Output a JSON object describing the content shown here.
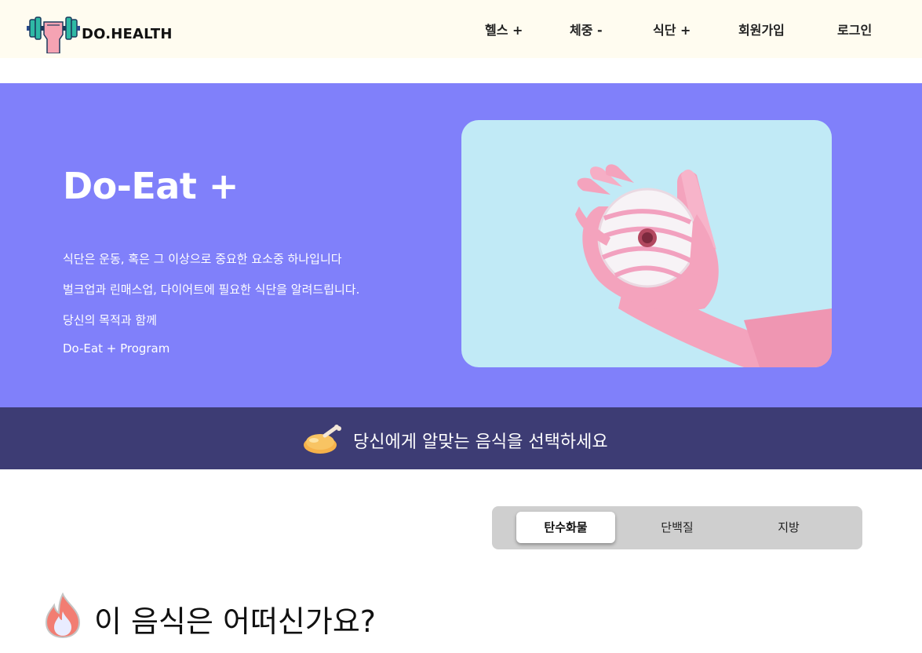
{
  "header": {
    "logo_text": "DO.HEALTH",
    "logo_icon": "dumbbell-fist-icon",
    "nav": [
      {
        "label": "헬스 +"
      },
      {
        "label": "체중 -"
      },
      {
        "label": "식단 +"
      },
      {
        "label": "회원가입"
      },
      {
        "label": "로그인"
      }
    ]
  },
  "hero": {
    "title": "Do-Eat +",
    "lines": [
      "식단은 운동, 혹은 그 이상으로 중요한 요소중 하나입니다",
      "벌크업과 린매스업, 다이어트에 필요한 식단을 알려드립니다.",
      "당신의 목적과 함께",
      "Do-Eat + Program"
    ],
    "image_icon": "donut-in-glove-image"
  },
  "banner": {
    "icon": "roast-chicken-icon",
    "text": "당신에게 알맞는 음식을 선택하세요"
  },
  "tabs": {
    "items": [
      {
        "label": "탄수화물",
        "active": true
      },
      {
        "label": "단백질",
        "active": false
      },
      {
        "label": "지방",
        "active": false
      }
    ]
  },
  "section": {
    "icon": "fire-icon",
    "title": "이 음식은 어떠신가요?"
  },
  "colors": {
    "header_bg": "#fffcf0",
    "hero_bg": "#8080fa",
    "banner_bg": "#3d3c74",
    "card_bg": "#c1eaf6",
    "glove": "#f4a3bd"
  }
}
